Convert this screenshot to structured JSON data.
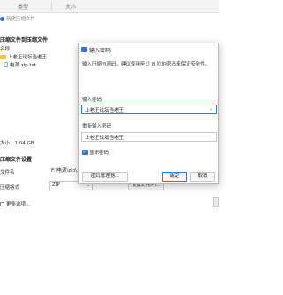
{
  "background": {
    "columns": {
      "type": "类型",
      "size": "大小"
    },
    "new_item": "新建压缩文件",
    "section_add": "压缩文件到压缩文件",
    "name_label": "名称",
    "tree": [
      {
        "icon": "folder-icon",
        "label": "上老王论坛当老王"
      },
      {
        "icon": "file-icon",
        "label": "电源.zip.txt"
      }
    ],
    "total_size": "大小：1.04 GB",
    "section_settings": "压缩文件设置",
    "file_name_label": "文件名",
    "file_name_value": "F:\\电源\\zip\\...",
    "format_label": "压缩格式",
    "format_value": "ZIP",
    "settings_button": "设置文件(P)...",
    "more_options": "更多选项..."
  },
  "dialog": {
    "title": "输入密码",
    "description": "输入压缩包密码。建议使用至少 8 位的密码来保证安全性。",
    "password_label": "输入密码",
    "password_value": "上老王论坛当老王",
    "confirm_label": "重新输入密码",
    "confirm_value": "上老王论坛当老王",
    "show_password": "显示密码",
    "manager_button": "密码管理器...",
    "ok_button": "确定",
    "cancel_button": "取消"
  },
  "colors": {
    "accent": "#2f72e4",
    "folder": "#f2c24d"
  }
}
